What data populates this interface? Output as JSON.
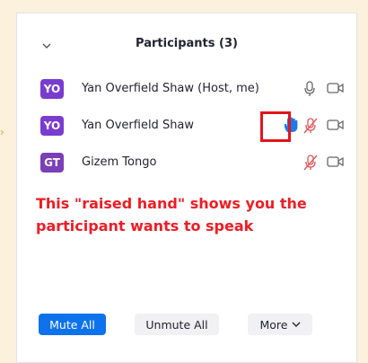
{
  "panel": {
    "title": "Participants (3)",
    "participants": [
      {
        "initials": "YO",
        "name": "Yan Overfield Shaw (Host, me)",
        "mic": "mic-icon",
        "video": "video-icon",
        "raised_hand": false,
        "muted": false
      },
      {
        "initials": "YO",
        "name": "Yan Overfield Shaw",
        "mic": "mic-muted-icon",
        "video": "video-icon",
        "raised_hand": true,
        "muted": true
      },
      {
        "initials": "GT",
        "name": "Gizem Tongo",
        "mic": "mic-muted-icon",
        "video": "video-icon",
        "raised_hand": false,
        "muted": true
      }
    ]
  },
  "annotation": {
    "line1": "This \"raised hand\" shows you the",
    "line2": "participant wants to speak"
  },
  "buttons": {
    "mute_all": "Mute All",
    "unmute_all": "Unmute All",
    "more": "More"
  },
  "colors": {
    "accent_blue": "#0e72ed",
    "avatar_purple": "#7a3ccf",
    "annotation_red": "#ee1c24",
    "muted_red": "#e0585b"
  }
}
